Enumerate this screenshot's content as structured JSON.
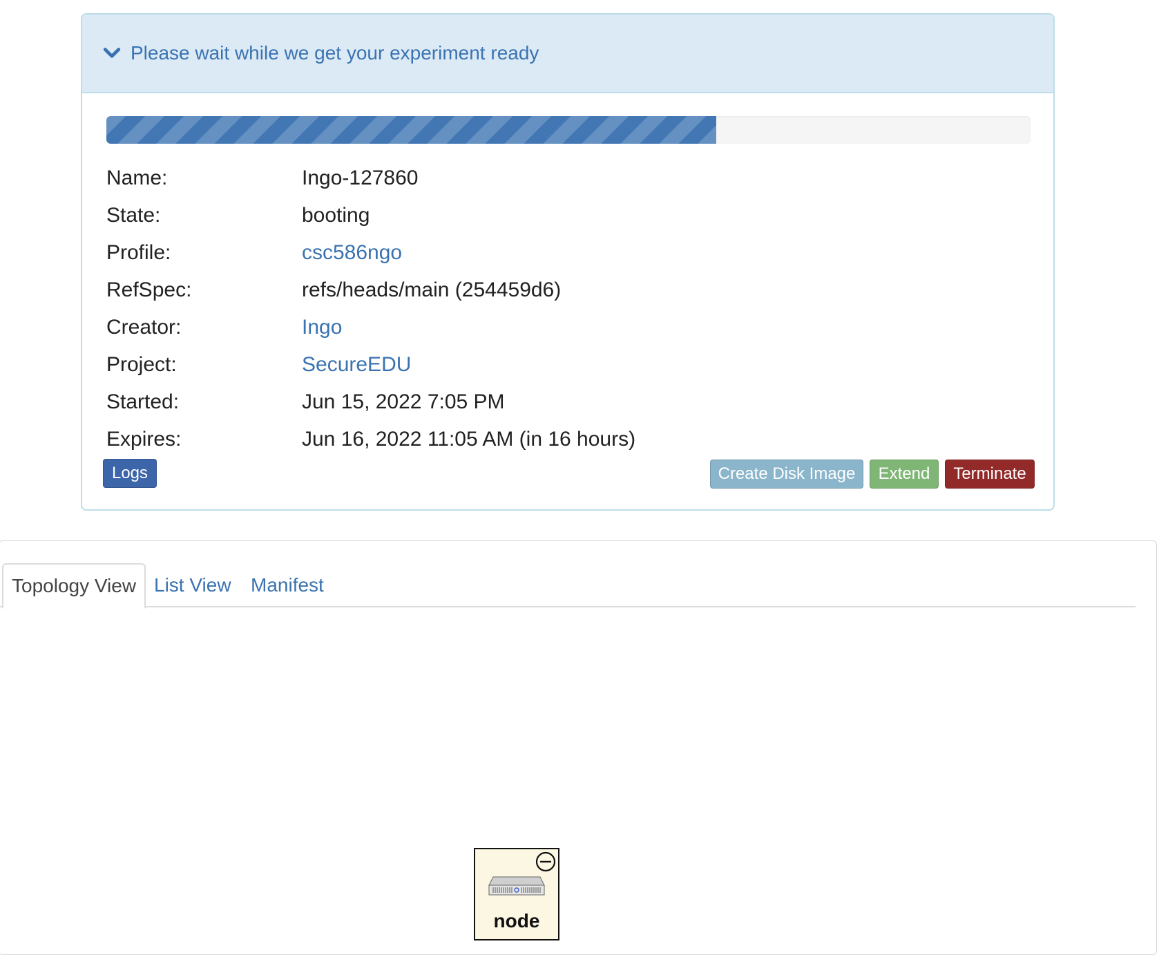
{
  "panel": {
    "heading": "Please wait while we get your experiment ready",
    "progress_fraction": 0.66
  },
  "info": [
    {
      "label": "Name:",
      "value": "Ingo-127860",
      "is_link": false
    },
    {
      "label": "State:",
      "value": "booting",
      "is_link": false
    },
    {
      "label": "Profile:",
      "value": "csc586ngo",
      "is_link": true
    },
    {
      "label": "RefSpec:",
      "value": "refs/heads/main (254459d6)",
      "is_link": false
    },
    {
      "label": "Creator:",
      "value": "Ingo",
      "is_link": true
    },
    {
      "label": "Project:",
      "value": "SecureEDU",
      "is_link": true
    },
    {
      "label": "Started:",
      "value": "Jun 15, 2022 7:05 PM",
      "is_link": false
    },
    {
      "label": "Expires:",
      "value": "Jun 16, 2022 11:05 AM (in 16 hours)",
      "is_link": false
    }
  ],
  "buttons": {
    "logs": "Logs",
    "create_disk_image": "Create Disk Image",
    "extend": "Extend",
    "terminate": "Terminate"
  },
  "tabs": {
    "topology": "Topology View",
    "list": "List View",
    "manifest": "Manifest"
  },
  "topology": {
    "node_label": "node"
  },
  "colors": {
    "link": "#3a73b0",
    "heading_bg": "#dceaf6",
    "progress": "#4277b4",
    "logs": "#3c65aa",
    "disk": "#8ab5ca",
    "extend": "#7fb675",
    "terminate": "#922a29",
    "node_bg": "#fbf7e2"
  },
  "icons": {
    "heading": "chevron-down-icon",
    "node_status": "minus-circle-icon",
    "node_type": "server-icon"
  }
}
